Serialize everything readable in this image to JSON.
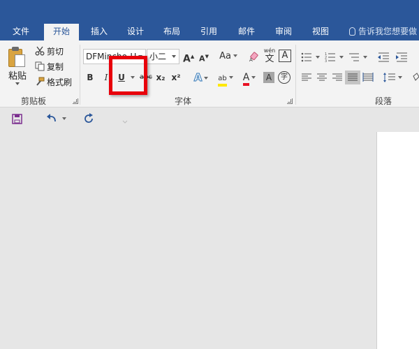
{
  "tabs": [
    {
      "label": "文件",
      "active": false
    },
    {
      "label": "开始",
      "active": true
    },
    {
      "label": "插入",
      "active": false
    },
    {
      "label": "设计",
      "active": false
    },
    {
      "label": "布局",
      "active": false
    },
    {
      "label": "引用",
      "active": false
    },
    {
      "label": "邮件",
      "active": false
    },
    {
      "label": "审阅",
      "active": false
    },
    {
      "label": "视图",
      "active": false
    }
  ],
  "tell_me": "告诉我您想要做",
  "clipboard": {
    "paste": "粘贴",
    "cut": "剪切",
    "copy": "复制",
    "format_painter": "格式刷",
    "group_label": "剪贴板"
  },
  "font": {
    "font_name": "DFMincho-U",
    "font_size": "小二",
    "group_label": "字体",
    "bold": "B",
    "italic": "I",
    "underline": "U",
    "strikethrough": "abc",
    "subscript": "x₂",
    "superscript": "x²",
    "grow": "A",
    "shrink": "A",
    "change_case": "Aa",
    "phonetic": "wén",
    "phonetic_char": "文",
    "char_border": "A",
    "text_effect": "A",
    "highlight": "ab",
    "font_color": "A",
    "char_shading": "A",
    "enclose": "字"
  },
  "paragraph": {
    "group_label": "段落"
  },
  "colors": {
    "brand_blue": "#2b579a",
    "highlight_yellow": "#ffe800",
    "font_red": "#e81123",
    "annotation_red": "#e8000b"
  }
}
